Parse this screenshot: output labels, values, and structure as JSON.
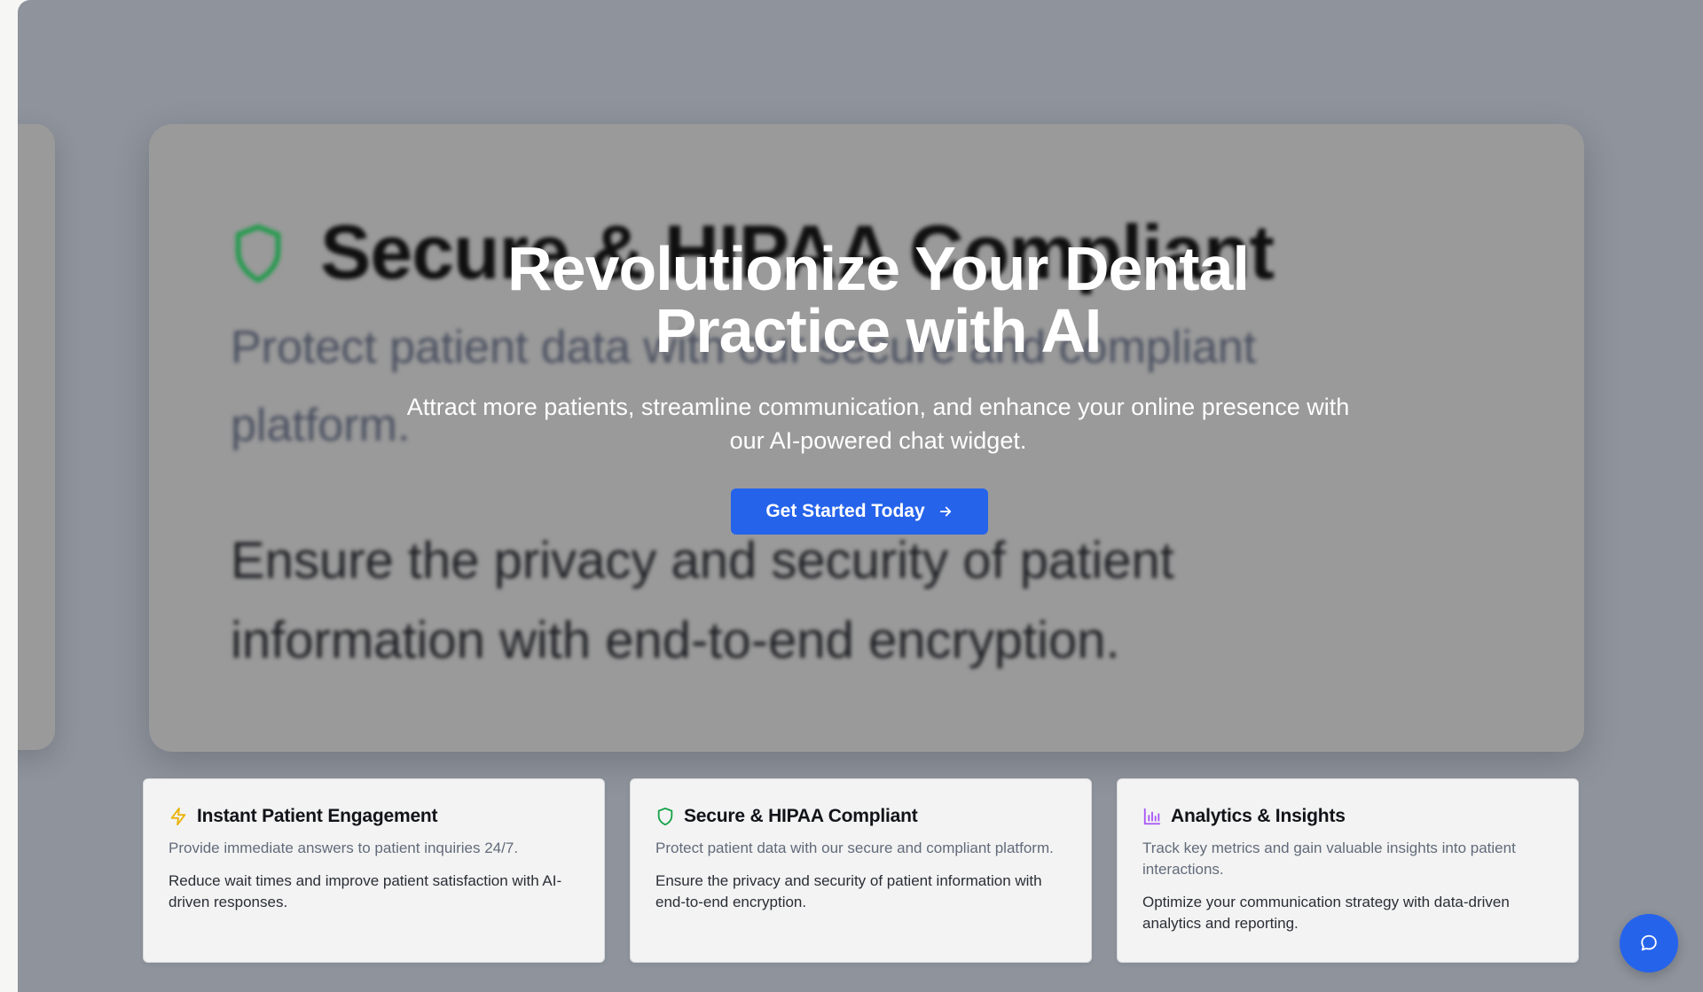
{
  "background_card": {
    "title": "Secure & HIPAA Compliant",
    "description": "Protect patient data with our secure and compliant platform.",
    "body": "Ensure the privacy and security of patient information with end-to-end encryption."
  },
  "hero": {
    "title": "Revolutionize Your Dental Practice with AI",
    "subtitle": "Attract more patients, streamline communication, and enhance your online presence with our AI-powered chat widget.",
    "cta_label": "Get Started Today"
  },
  "features": [
    {
      "icon": "lightning-icon",
      "title": "Instant Patient Engagement",
      "description": "Provide immediate answers to patient inquiries 24/7.",
      "body": "Reduce wait times and improve patient satisfaction with AI-driven responses."
    },
    {
      "icon": "shield-icon",
      "title": "Secure & HIPAA Compliant",
      "description": "Protect patient data with our secure and compliant platform.",
      "body": "Ensure the privacy and security of patient information with end-to-end encryption."
    },
    {
      "icon": "bar-chart-icon",
      "title": "Analytics & Insights",
      "description": "Track key metrics and gain valuable insights into patient interactions.",
      "body": "Optimize your communication strategy with data-driven analytics and reporting."
    }
  ],
  "colors": {
    "accent": "#2563eb",
    "lightning": "#eab308",
    "shield": "#16a34a",
    "chart": "#a855f7"
  },
  "chat_widget": {
    "icon": "chat-bubble-icon"
  }
}
